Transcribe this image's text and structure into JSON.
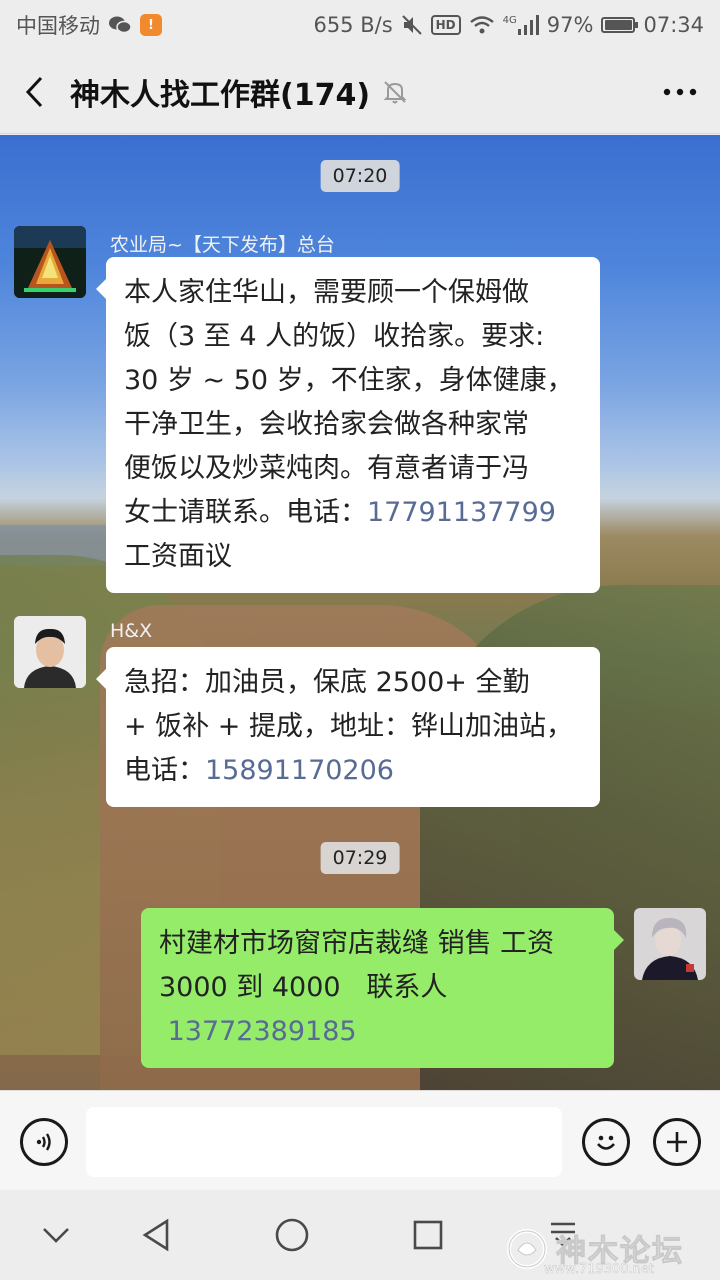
{
  "status_bar": {
    "carrier": "中国移动",
    "net_speed": "655 B/s",
    "hd": "HD",
    "network": "4G",
    "battery": "97%",
    "time": "07:34"
  },
  "header": {
    "title": "神木人找工作群(174)"
  },
  "chat": {
    "time_1": "07:20",
    "time_2": "07:29",
    "messages": [
      {
        "sender": "农业局~【天下发布】总台",
        "line1": "本人家住华山，需要顾一个保姆做",
        "line2": "饭（3 至 4 人的饭）收拾家。要求:",
        "line3": "30 岁 ~ 50 岁，不住家，身体健康，",
        "line4": "干净卫生，会收拾家会做各种家常",
        "line5": "便饭以及炒菜炖肉。有意者请于冯",
        "line6_prefix": "女士请联系。电话：",
        "phone": "17791137799",
        "line7": "工资面议"
      },
      {
        "sender": "H&X",
        "line1": "急招：加油员，保底 2500+ 全勤",
        "line2": "+ 饭补 + 提成，地址：铧山加油站，",
        "line3_prefix": "电话：",
        "phone": "15891170206"
      },
      {
        "line1": "村建材市场窗帘店裁缝 销售 工资",
        "line2": "3000 到 4000   联系人",
        "phone": "13772389185"
      }
    ]
  },
  "input": {
    "placeholder": ""
  },
  "watermark": {
    "text": "神木论坛",
    "url": "www.719300.net"
  },
  "colors": {
    "link": "#576b95",
    "self_bubble": "#95ec69"
  }
}
